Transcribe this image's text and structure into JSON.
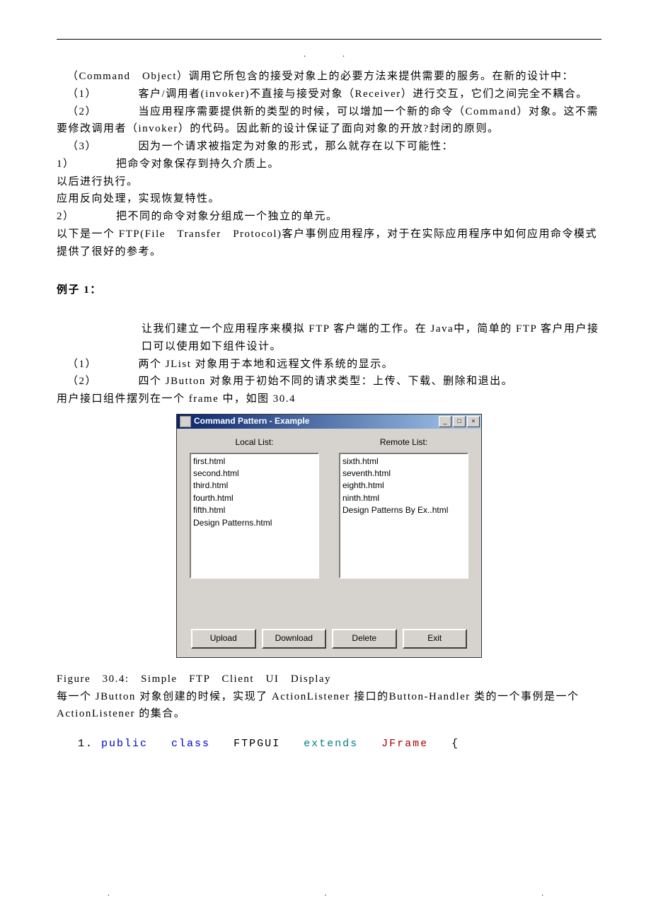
{
  "p1": "（Command　Object）调用它所包含的接受对象上的必要方法来提供需要的服务。在新的设计中：",
  "p2": "（1）　　　　客户/调用者(invoker)不直接与接受对象（Receiver）进行交互，它们之间完全不耦合。",
  "p3": "（2）　　　　当应用程序需要提供新的类型的时候，可以增加一个新的命令（Command）对象。这不需要修改调用者（invoker）的代码。因此新的设计保证了面向对象的开放?封闭的原则。",
  "p4": "（3）　　　　因为一个请求被指定为对象的形式，那么就存在以下可能性：",
  "p5": "1）　　　　把命令对象保存到持久介质上。",
  "p6": "以后进行执行。",
  "p7": "应用反向处理，实现恢复特性。",
  "p8": "2）　　　　把不同的命令对象分组成一个独立的单元。",
  "p9": "以下是一个 FTP(File　Transfer　Protocol)客户事例应用程序，对于在实际应用程序中如何应用命令模式提供了很好的参考。",
  "example_heading": "例子 1：",
  "p10": "让我们建立一个应用程序来模拟 FTP 客户端的工作。在 Java中，简单的 FTP 客户用户接口可以使用如下组件设计。",
  "p11": "（1）　　　　两个 JList 对象用于本地和远程文件系统的显示。",
  "p12": "（2）　　　　四个 JButton 对象用于初始不同的请求类型：上传、下载、删除和退出。",
  "p13": "用户接口组件摆列在一个 frame 中，如图 30.4",
  "figure_caption": "Figure　30.4:　Simple　FTP　Client　UI　Display",
  "p14": "每一个 JButton 对象创建的时候，实现了 ActionListener 接口的Button-Handler 类的一个事例是一个 ActionListener 的集合。",
  "code": {
    "num": "1. ",
    "kw_public": "public",
    "kw_class": "class",
    "name": "FTPGUI",
    "kw_extends": "extends",
    "super": "JFrame",
    "brace": "{"
  },
  "app": {
    "title": "Command Pattern - Example",
    "local_label": "Local List:",
    "remote_label": "Remote List:",
    "local_items": [
      "first.html",
      "second.html",
      "third.html",
      "fourth.html",
      "fifth.html",
      "Design Patterns.html"
    ],
    "remote_items": [
      "sixth.html",
      "seventh.html",
      "eighth.html",
      "ninth.html",
      "Design Patterns By Ex..html"
    ],
    "buttons": {
      "upload": "Upload",
      "download": "Download",
      "delete": "Delete",
      "exit": "Exit"
    },
    "win": {
      "min": "_",
      "max": "□",
      "close": "×"
    }
  }
}
